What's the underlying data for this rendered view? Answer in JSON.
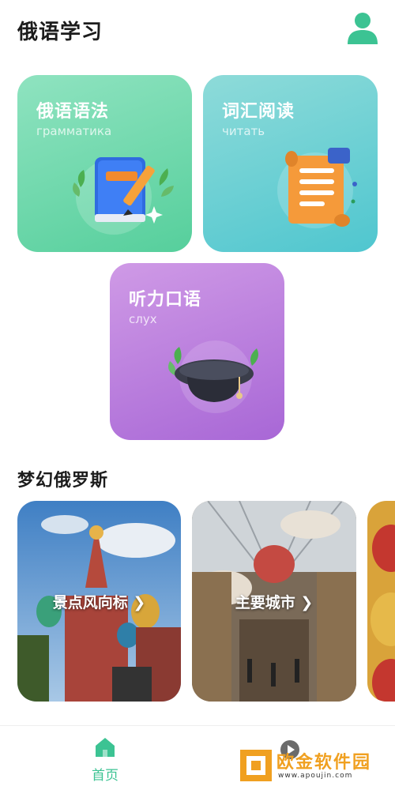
{
  "header": {
    "app_title": "俄语学习"
  },
  "cards": [
    {
      "title": "俄语语法",
      "subtitle": "грамматика",
      "icon": "grammar-book-icon"
    },
    {
      "title": "词汇阅读",
      "subtitle": "читать",
      "icon": "scroll-icon"
    },
    {
      "title": "听力口语",
      "subtitle": "слух",
      "icon": "graduation-cap-icon"
    }
  ],
  "section": {
    "title": "梦幻俄罗斯"
  },
  "photos": [
    {
      "label": "景点风向标 ❯"
    },
    {
      "label": "主要城市 ❯"
    }
  ],
  "bottom_nav": {
    "home_label": "首页"
  },
  "watermark": {
    "text": "欧金软件园",
    "url": "www.apoujin.com"
  },
  "colors": {
    "accent": "#3cc393",
    "grammar_card": "#56cf9c",
    "vocab_card": "#4fc6cf",
    "listen_card": "#a867d6"
  }
}
